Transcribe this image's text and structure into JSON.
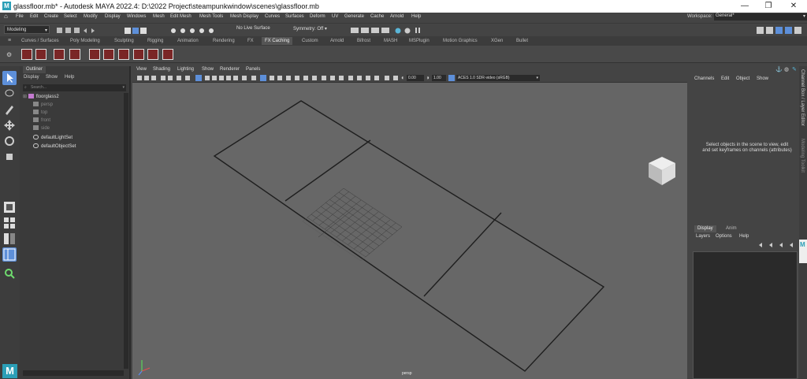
{
  "app": {
    "window_title": "glassfloor.mb* - Autodesk MAYA 2022.4: D:\\2022 Project\\steampunkwindow\\scenes\\glassfloor.mb",
    "logo_letter": "M",
    "window_controls": [
      "—",
      "❐",
      "✕"
    ]
  },
  "menubar": {
    "items": [
      "File",
      "Edit",
      "Create",
      "Select",
      "Modify",
      "Display",
      "Windows",
      "Mesh",
      "Edit Mesh",
      "Mesh Tools",
      "Mesh Display",
      "Curves",
      "Surfaces",
      "Deform",
      "UV",
      "Generate",
      "Cache",
      "Arnold",
      "Help"
    ],
    "workspace_label": "Workspace:",
    "workspace_value": "General*"
  },
  "statusline": {
    "mode": "Modeling",
    "live_surface": "No Live Surface",
    "symmetry": "Symmetry: Off"
  },
  "shelf": {
    "tabs": [
      "Curves / Surfaces",
      "Poly Modeling",
      "Sculpting",
      "Rigging",
      "Animation",
      "Rendering",
      "FX",
      "FX Caching",
      "Custom",
      "Arnold",
      "Bifrost",
      "MASH",
      "MSPlugin",
      "Motion Graphics",
      "XGen",
      "Bullet"
    ],
    "active_tab": "FX Caching"
  },
  "outliner": {
    "tab": "Outliner",
    "menu": [
      "Display",
      "Show",
      "Help"
    ],
    "search_placeholder": "Search...",
    "items": [
      {
        "label": "floorglass2",
        "type": "mesh",
        "dim": false
      },
      {
        "label": "persp",
        "type": "camera",
        "dim": true
      },
      {
        "label": "top",
        "type": "camera",
        "dim": true
      },
      {
        "label": "front",
        "type": "camera",
        "dim": true
      },
      {
        "label": "side",
        "type": "camera",
        "dim": true
      },
      {
        "label": "defaultLightSet",
        "type": "set",
        "dim": false
      },
      {
        "label": "defaultObjectSet",
        "type": "set",
        "dim": false
      }
    ]
  },
  "viewport": {
    "menu": [
      "View",
      "Shading",
      "Lighting",
      "Show",
      "Renderer",
      "Panels"
    ],
    "exposure": "0.00",
    "gamma": "1.00",
    "color_space": "ACES 1.0 SDR-video (sRGB)",
    "camera_label": "persp"
  },
  "channel_box": {
    "menu": [
      "Channels",
      "Edit",
      "Object",
      "Show"
    ],
    "message": "Select objects in the scene to view, edit and set keyframes on channels (attributes)",
    "side_label_1": "Channel Box / Layer Editor",
    "side_label_2": "Modeling Toolkit"
  },
  "layer_editor": {
    "tabs": [
      "Display",
      "Anim"
    ],
    "menu": [
      "Layers",
      "Options",
      "Help"
    ]
  },
  "colors": {
    "accent": "#2b9fb7",
    "viewport_bg": "#656565",
    "shelf_icon": "#7a2626"
  }
}
